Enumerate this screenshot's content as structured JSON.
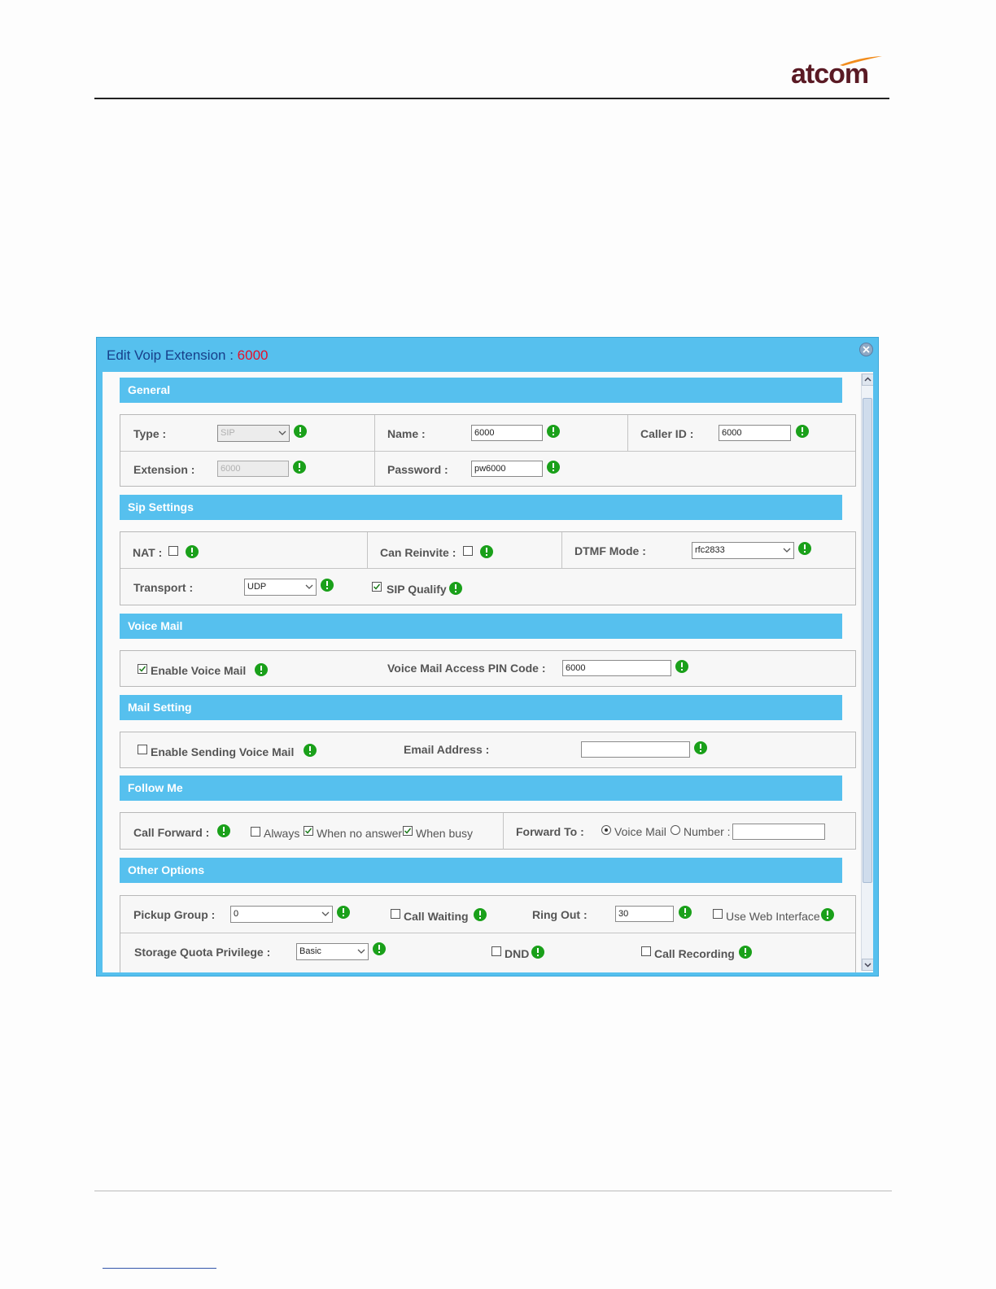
{
  "logo": {
    "text": "atcom"
  },
  "dialog": {
    "title_prefix": "Edit Voip Extension : ",
    "title_ext": "6000",
    "sections": {
      "general": "General",
      "sip": "Sip Settings",
      "voicemail": "Voice Mail",
      "mail": "Mail Setting",
      "follow": "Follow Me",
      "other": "Other Options"
    },
    "general": {
      "type_label": "Type :",
      "type_value": "SIP",
      "name_label": "Name :",
      "name_value": "6000",
      "callerid_label": "Caller ID :",
      "callerid_value": "6000",
      "extension_label": "Extension :",
      "extension_value": "6000",
      "password_label": "Password :",
      "password_value": "pw6000"
    },
    "sip": {
      "nat_label": "NAT :",
      "reinvite_label": "Can Reinvite :",
      "dtmf_label": "DTMF Mode :",
      "dtmf_value": "rfc2833",
      "transport_label": "Transport :",
      "transport_value": "UDP",
      "qualify_label": "SIP Qualify"
    },
    "voicemail": {
      "enable_label": "Enable Voice Mail",
      "pin_label": "Voice Mail Access PIN Code :",
      "pin_value": "6000"
    },
    "mail": {
      "enable_label": "Enable Sending Voice Mail",
      "email_label": "Email Address :",
      "email_value": ""
    },
    "follow": {
      "forward_label": "Call Forward :",
      "always_label": "Always",
      "noanswer_label": "When no answer",
      "busy_label": "When busy",
      "forward_to_label": "Forward To :",
      "voicemail_label": "Voice Mail",
      "number_label": "Number :",
      "number_value": ""
    },
    "other": {
      "pickup_label": "Pickup Group :",
      "pickup_value": "0",
      "waiting_label": "Call Waiting",
      "ringout_label": "Ring Out :",
      "ringout_value": "30",
      "webif_label": "Use Web Interface",
      "quota_label": "Storage Quota Privilege :",
      "quota_value": "Basic",
      "dnd_label": "DND",
      "recording_label": "Call Recording"
    }
  },
  "colors": {
    "accent": "#56c0ee",
    "title": "#173f8a",
    "extension": "#e5102a",
    "info": "#1aa01a"
  }
}
